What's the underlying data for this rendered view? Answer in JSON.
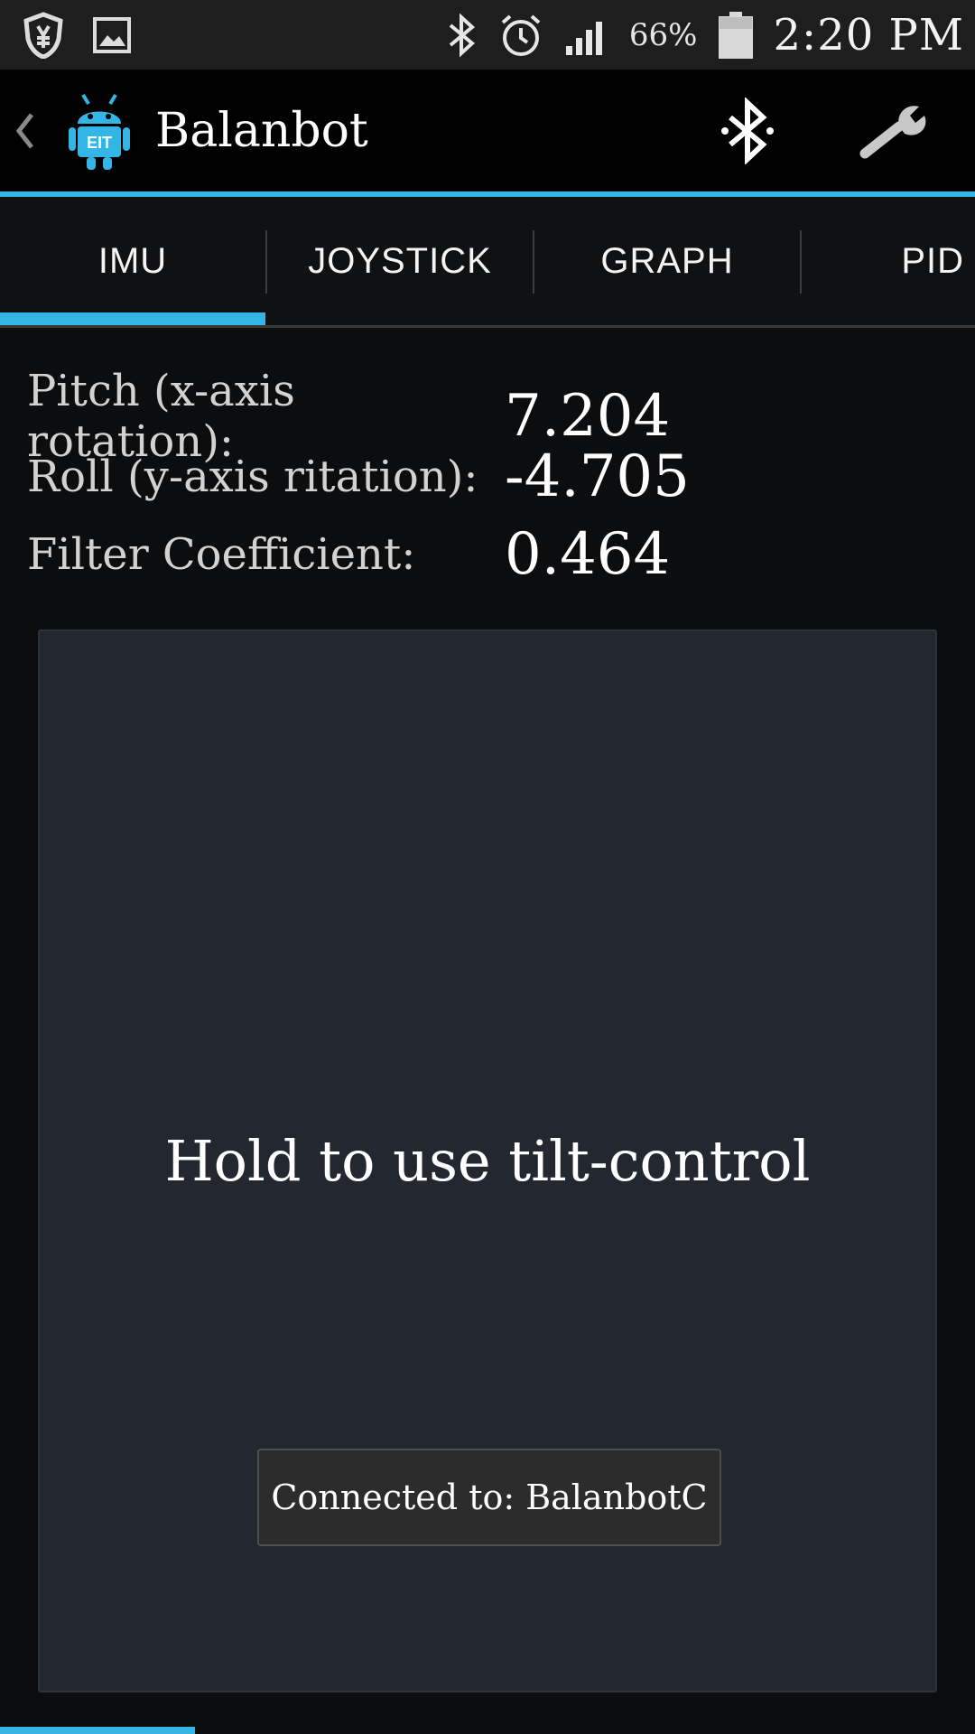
{
  "status_bar": {
    "battery_percent": "66%",
    "time": "2:20 PM",
    "icons": [
      "shield-icon",
      "image-icon",
      "bluetooth-icon",
      "alarm-icon",
      "signal-icon",
      "battery-icon"
    ]
  },
  "action_bar": {
    "title": "Balanbot",
    "app_icon_text": "EIT",
    "actions": [
      "bluetooth-icon",
      "wrench-icon"
    ]
  },
  "tabs": [
    {
      "label": "IMU",
      "selected": true
    },
    {
      "label": "JOYSTICK",
      "selected": false
    },
    {
      "label": "GRAPH",
      "selected": false
    },
    {
      "label": "PID",
      "selected": false
    }
  ],
  "readings": [
    {
      "label": "Pitch (x-axis rotation):",
      "value": "7.204"
    },
    {
      "label": "Roll (y-axis ritation):",
      "value": "-4.705"
    },
    {
      "label": "Filter Coefficient:",
      "value": "0.464"
    }
  ],
  "tilt_control": {
    "label": "Hold to use tilt-control"
  },
  "toast": {
    "message": "Connected to: BalanbotC"
  },
  "colors": {
    "accent": "#33b5e5",
    "panel": "#232830",
    "background": "#0c0d0f"
  }
}
